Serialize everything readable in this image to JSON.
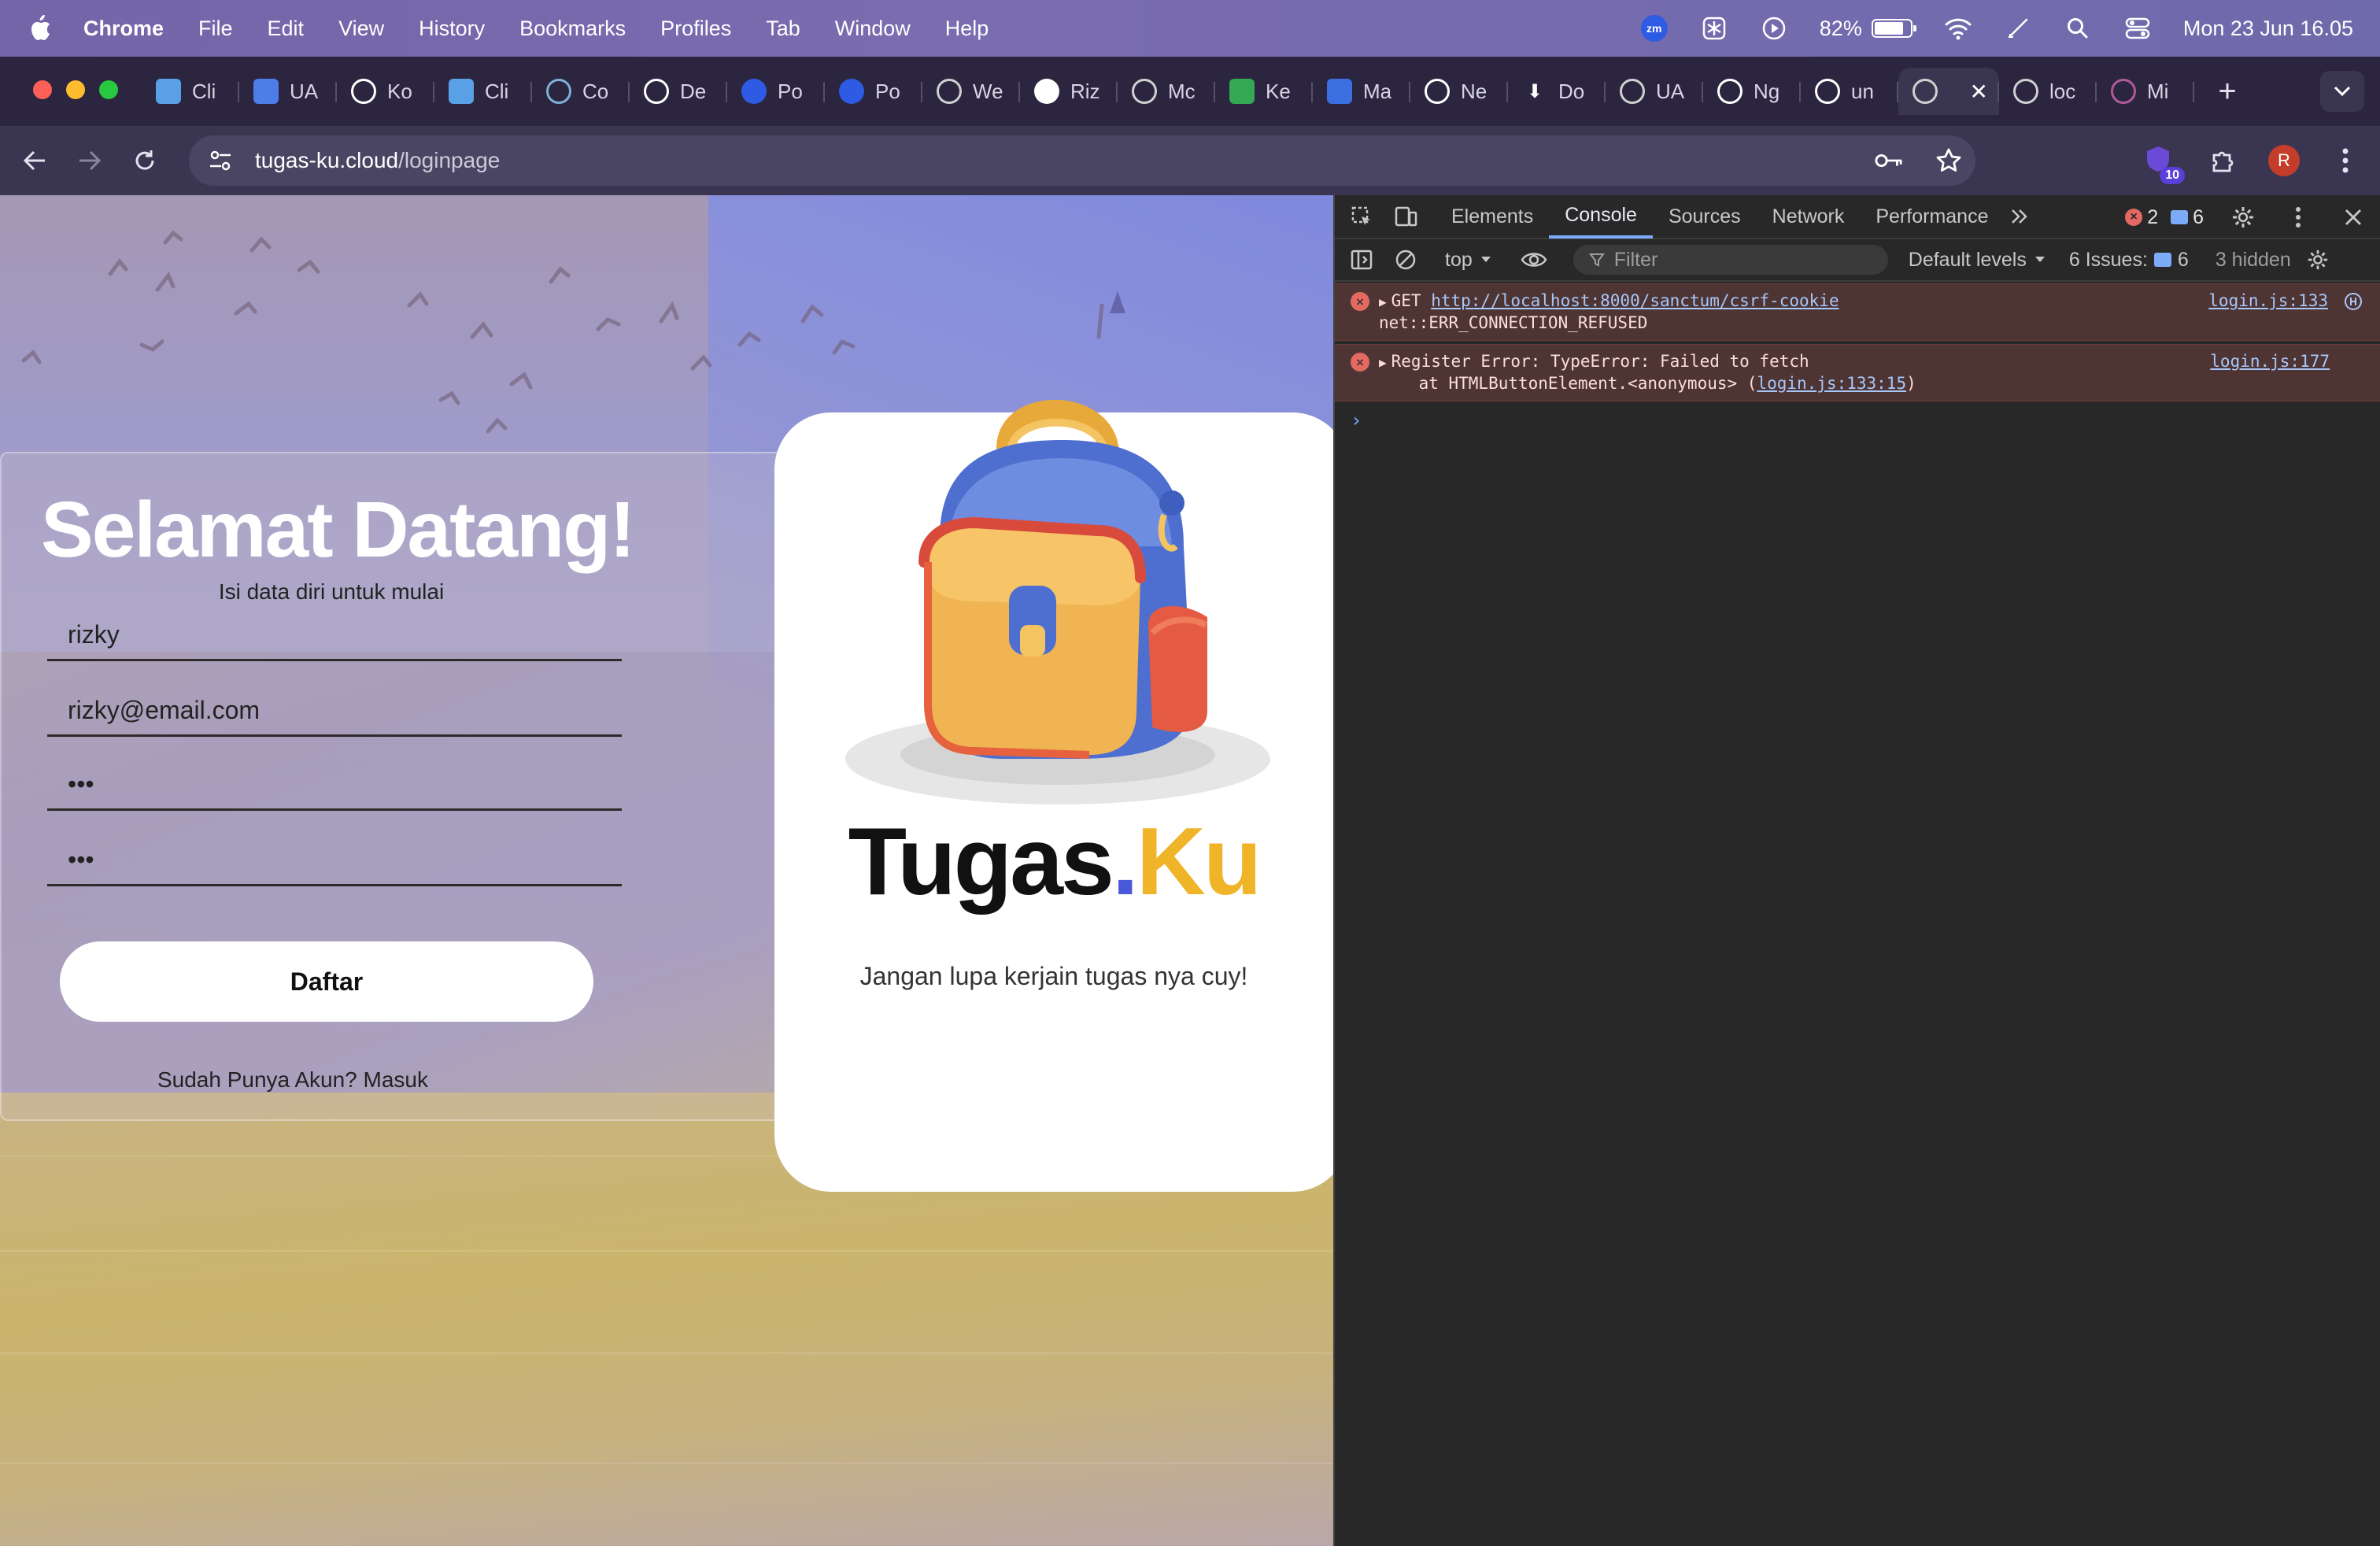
{
  "menubar": {
    "app_name": "Chrome",
    "items": [
      "File",
      "Edit",
      "View",
      "History",
      "Bookmarks",
      "Profiles",
      "Tab",
      "Window",
      "Help"
    ],
    "battery_percent": "82%",
    "battery_level": 0.82,
    "datetime": "Mon 23 Jun  16.05",
    "zoom_badge": "zm"
  },
  "tabs": [
    {
      "label": "Cli",
      "icon": "house-icon",
      "color": "#5aa0e6"
    },
    {
      "label": "UA",
      "icon": "doc-icon",
      "color": "#4d7de8"
    },
    {
      "label": "Ko",
      "icon": "openai-icon",
      "color": "#ffffff"
    },
    {
      "label": "Cli",
      "icon": "house-icon",
      "color": "#5aa0e6"
    },
    {
      "label": "Co",
      "icon": "circle-icon",
      "color": "#7fb0d8"
    },
    {
      "label": "De",
      "icon": "openai-icon",
      "color": "#ffffff"
    },
    {
      "label": "Po",
      "icon": "zoom-icon",
      "color": "#2d5be3"
    },
    {
      "label": "Po",
      "icon": "zoom-icon",
      "color": "#2d5be3"
    },
    {
      "label": "We",
      "icon": "globe-icon",
      "color": "#d0d0d0"
    },
    {
      "label": "Riz",
      "icon": "github-icon",
      "color": "#ffffff"
    },
    {
      "label": "Mc",
      "icon": "globe-icon",
      "color": "#d0d0d0"
    },
    {
      "label": "Ke",
      "icon": "sheets-icon",
      "color": "#34a853"
    },
    {
      "label": "Ma",
      "icon": "shield-icon",
      "color": "#3b6fe0"
    },
    {
      "label": "Ne",
      "icon": "openai-icon",
      "color": "#ffffff"
    },
    {
      "label": "Do",
      "icon": "download-icon",
      "color": "#ffffff"
    },
    {
      "label": "UA",
      "icon": "globe-icon",
      "color": "#d0d0d0"
    },
    {
      "label": "Ng",
      "icon": "openai-icon",
      "color": "#ffffff"
    },
    {
      "label": "un",
      "icon": "google-icon",
      "color": "#ffffff"
    },
    {
      "label": "",
      "icon": "globe-icon",
      "color": "#d0d0d0",
      "active": true
    },
    {
      "label": "loc",
      "icon": "globe-icon",
      "color": "#d0d0d0"
    },
    {
      "label": "Mi",
      "icon": "ring-icon",
      "color": "#b05a9a"
    }
  ],
  "toolbar": {
    "url_host": "tugas-ku.cloud",
    "url_path": "/loginpage",
    "extension_badge": "10",
    "avatar_letter": "R"
  },
  "page": {
    "title": "Selamat Datang!",
    "subtitle": "Isi data diri untuk mulai",
    "fields": {
      "name": "rizky",
      "email": "rizky@email.com",
      "password": "•••",
      "confirm_password": "•••"
    },
    "submit_label": "Daftar",
    "login_prompt": "Sudah Punya Akun? Masuk",
    "brand_main": "Tugas",
    "brand_dot": ".",
    "brand_accent": "Ku",
    "tagline": "Jangan lupa kerjain tugas nya cuy!",
    "colors": {
      "brand_dot": "#4758d9",
      "brand_accent": "#f0b429"
    }
  },
  "devtools": {
    "tabs": [
      "Elements",
      "Console",
      "Sources",
      "Network",
      "Performance"
    ],
    "active_tab": "Console",
    "error_count": "2",
    "message_count": "6",
    "context": "top",
    "filter_placeholder": "Filter",
    "levels": "Default levels",
    "issues_label": "6 Issues:",
    "issues_count": "6",
    "hidden": "3 hidden",
    "messages": [
      {
        "line1_prefix": "GET ",
        "line1_link": "http://localhost:8000/sanctum/csrf-cookie",
        "line2": "net::ERR_CONNECTION_REFUSED",
        "source": "login.js:133"
      },
      {
        "line1_prefix": "Register Error: TypeError: Failed to fetch",
        "line2_prefix": "    at HTMLButtonElement.<anonymous> (",
        "line2_link": "login.js:133:15",
        "line2_suffix": ")",
        "source": "login.js:177"
      }
    ]
  }
}
